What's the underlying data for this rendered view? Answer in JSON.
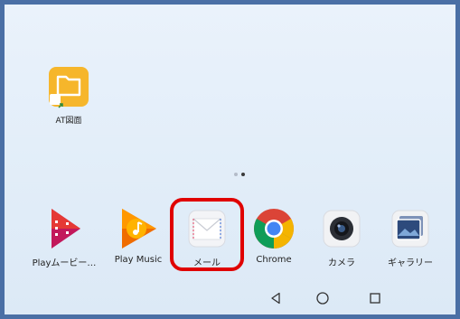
{
  "desktop": {
    "shortcut": {
      "label": "AT図面",
      "icon": "folder-icon",
      "color": "#f6b62b"
    }
  },
  "dock": {
    "apps": [
      {
        "label": "Playムービー…",
        "icon": "play-movies-icon"
      },
      {
        "label": "Play Music",
        "icon": "play-music-icon"
      },
      {
        "label": "メール",
        "icon": "mail-icon",
        "highlighted": true
      },
      {
        "label": "Chrome",
        "icon": "chrome-icon"
      },
      {
        "label": "カメラ",
        "icon": "camera-icon"
      },
      {
        "label": "ギャラリー",
        "icon": "gallery-icon"
      }
    ]
  },
  "page_indicator": {
    "pages": 2,
    "current": 2
  },
  "navbar": {
    "buttons": [
      "back-icon",
      "home-icon",
      "recents-icon"
    ]
  },
  "colors": {
    "frame": "#4a6fa5",
    "highlight": "#e00000"
  }
}
